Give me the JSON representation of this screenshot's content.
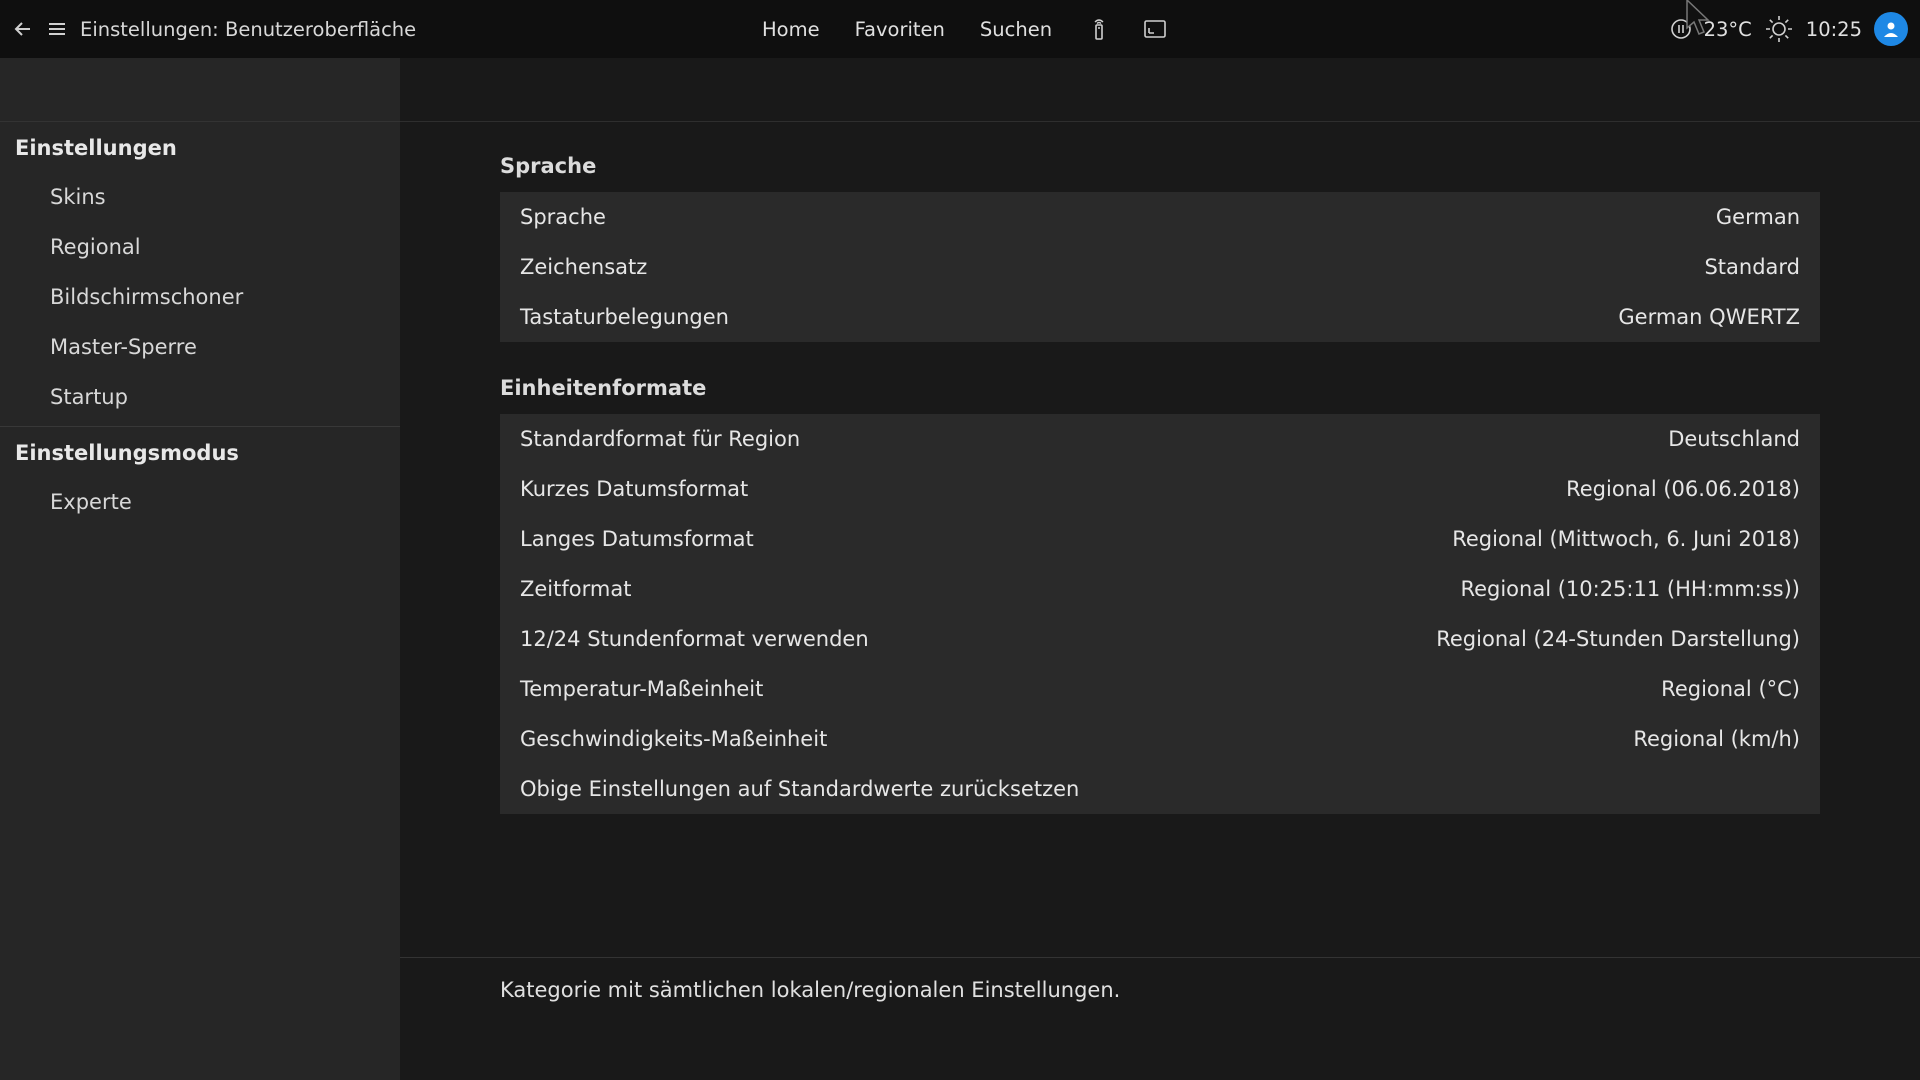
{
  "window": {
    "title": "Einstellungen: Benutzeroberfläche"
  },
  "nav": {
    "home": "Home",
    "favorites": "Favoriten",
    "search": "Suchen"
  },
  "status": {
    "temperature": "23°C",
    "time": "10:25"
  },
  "sidebar": {
    "groups": [
      {
        "heading": "Einstellungen",
        "items": [
          "Skins",
          "Regional",
          "Bildschirmschoner",
          "Master-Sperre",
          "Startup"
        ]
      },
      {
        "heading": "Einstellungsmodus",
        "items": [
          "Experte"
        ]
      }
    ]
  },
  "sections": [
    {
      "title": "Sprache",
      "rows": [
        {
          "label": "Sprache",
          "value": "German"
        },
        {
          "label": "Zeichensatz",
          "value": "Standard"
        },
        {
          "label": "Tastaturbelegungen",
          "value": "German QWERTZ"
        }
      ]
    },
    {
      "title": "Einheitenformate",
      "rows": [
        {
          "label": "Standardformat für Region",
          "value": "Deutschland"
        },
        {
          "label": "Kurzes Datumsformat",
          "value": "Regional (06.06.2018)"
        },
        {
          "label": "Langes Datumsformat",
          "value": "Regional (Mittwoch, 6. Juni 2018)"
        },
        {
          "label": "Zeitformat",
          "value": "Regional (10:25:11 (HH:mm:ss))"
        },
        {
          "label": "12/24 Stundenformat verwenden",
          "value": "Regional (24-Stunden Darstellung)"
        },
        {
          "label": "Temperatur-Maßeinheit",
          "value": "Regional (°C)"
        },
        {
          "label": "Geschwindigkeits-Maßeinheit",
          "value": "Regional (km/h)"
        },
        {
          "label": "Obige Einstellungen auf Standardwerte zurücksetzen",
          "value": ""
        }
      ]
    }
  ],
  "footer": {
    "description": "Kategorie mit sämtlichen lokalen/regionalen Einstellungen."
  },
  "icons": [
    "back-arrow-icon",
    "hamburger-menu-icon",
    "remote-icon",
    "screen-icon",
    "pause-icon",
    "sun-icon",
    "user-icon",
    "mouse-cursor-icon"
  ],
  "colors": {
    "accent": "#1e88e5",
    "background": "#191919",
    "sidebar": "#262626",
    "panel": "#2a2a2a"
  }
}
